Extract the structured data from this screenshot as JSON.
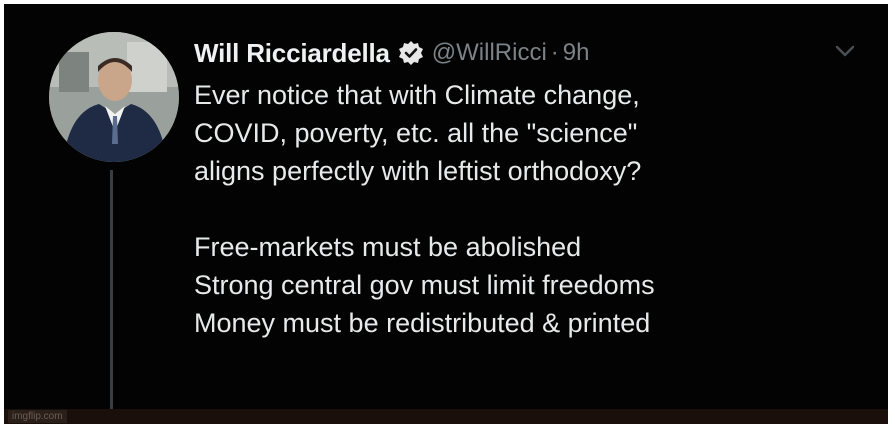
{
  "tweet": {
    "display_name": "Will Ricciardella",
    "handle": "@WillRicci",
    "separator": "·",
    "time": "9h",
    "paragraph_1": [
      "Ever notice that with Climate change,",
      "COVID, poverty, etc. all the \"science\"",
      "aligns perfectly with leftist orthodoxy?"
    ],
    "paragraph_2": [
      "Free-markets must be abolished",
      "Strong central gov must limit freedoms",
      "Money must be redistributed & printed"
    ]
  },
  "icons": {
    "verified": "verified-badge-icon",
    "more": "chevron-down-icon"
  },
  "colors": {
    "background": "#030303",
    "text": "#e7e9ea",
    "muted": "#7b8288"
  },
  "watermark": "imgflip.com"
}
